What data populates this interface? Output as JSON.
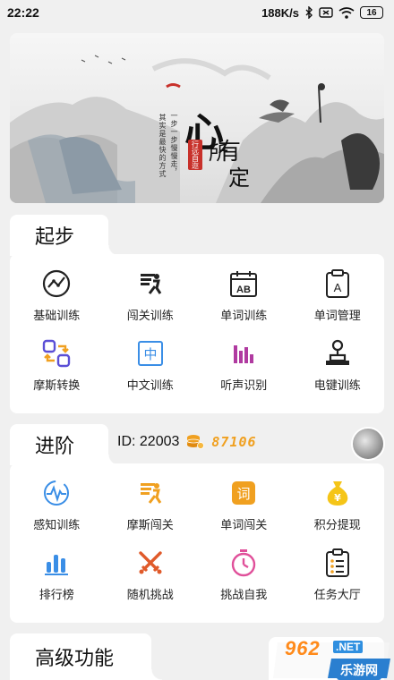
{
  "status": {
    "time": "22:22",
    "speed": "188K/s",
    "battery": "16"
  },
  "banner": {
    "heart": "心",
    "you": "有",
    "suo": "所",
    "ding": "定",
    "seal": "行远自迩",
    "vtext1": "一步一步慢慢走，",
    "vtext2": "其实是最快的方式"
  },
  "start": {
    "title": "起步",
    "items": [
      {
        "label": "基础训练",
        "icon": "chart-curve-icon"
      },
      {
        "label": "闯关训练",
        "icon": "runner-icon"
      },
      {
        "label": "单词训练",
        "icon": "calendar-ab-icon"
      },
      {
        "label": "单词管理",
        "icon": "clipboard-a-icon"
      },
      {
        "label": "摩斯转换",
        "icon": "swap-icon"
      },
      {
        "label": "中文训练",
        "icon": "zhong-icon"
      },
      {
        "label": "听声识别",
        "icon": "sound-bars-icon"
      },
      {
        "label": "电键训练",
        "icon": "telegraph-key-icon"
      }
    ]
  },
  "advanced": {
    "title": "进阶",
    "user_id": "ID: 22003",
    "coins": "87106",
    "items": [
      {
        "label": "感知训练",
        "icon": "pulse-icon"
      },
      {
        "label": "摩斯闯关",
        "icon": "runner-orange-icon"
      },
      {
        "label": "单词闯关",
        "icon": "ci-icon"
      },
      {
        "label": "积分提现",
        "icon": "money-bag-icon"
      },
      {
        "label": "排行榜",
        "icon": "ranking-icon"
      },
      {
        "label": "随机挑战",
        "icon": "swords-icon"
      },
      {
        "label": "挑战自我",
        "icon": "stopwatch-icon"
      },
      {
        "label": "任务大厅",
        "icon": "task-list-icon"
      }
    ]
  },
  "pro": {
    "title": "高级功能"
  },
  "watermark": {
    "brand": "962",
    "net": ".NET",
    "cn": "乐游网"
  },
  "colors": {
    "accent": "#f0a020",
    "blue": "#3a8ee6",
    "purple": "#b03aa0",
    "red": "#e05a2a"
  }
}
